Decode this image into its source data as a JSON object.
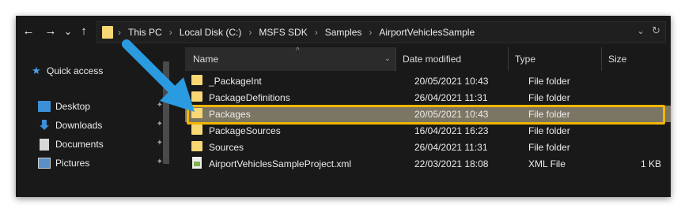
{
  "navigation": {
    "back_icon": "←",
    "forward_icon": "→",
    "recent_icon": "⌄",
    "up_icon": "↑"
  },
  "address": {
    "crumbs": [
      "This PC",
      "Local Disk (C:)",
      "MSFS SDK",
      "Samples",
      "AirportVehiclesSample"
    ],
    "separator": "›",
    "dropdown_icon": "⌄",
    "refresh_icon": "↻"
  },
  "sidebar": {
    "quick_access": "Quick access",
    "items": [
      {
        "label": "Desktop",
        "icon": "desktop-icon"
      },
      {
        "label": "Downloads",
        "icon": "downloads-icon"
      },
      {
        "label": "Documents",
        "icon": "documents-icon"
      },
      {
        "label": "Pictures",
        "icon": "pictures-icon"
      }
    ],
    "pin_icon": "📌"
  },
  "columns": {
    "name": "Name",
    "date": "Date modified",
    "type": "Type",
    "size": "Size",
    "sort_icon": "^",
    "name_dropdown_icon": "⌄"
  },
  "files": [
    {
      "name": "_PackageInt",
      "date": "20/05/2021 10:43",
      "type": "File folder",
      "size": "",
      "icon": "folder-icon"
    },
    {
      "name": "PackageDefinitions",
      "date": "26/04/2021 11:31",
      "type": "File folder",
      "size": "",
      "icon": "folder-icon"
    },
    {
      "name": "Packages",
      "date": "20/05/2021 10:43",
      "type": "File folder",
      "size": "",
      "icon": "folder-icon",
      "selected": true
    },
    {
      "name": "PackageSources",
      "date": "16/04/2021 16:23",
      "type": "File folder",
      "size": "",
      "icon": "folder-icon"
    },
    {
      "name": "Sources",
      "date": "26/04/2021 11:31",
      "type": "File folder",
      "size": "",
      "icon": "folder-icon"
    },
    {
      "name": "AirportVehiclesSampleProject.xml",
      "date": "22/03/2021 18:08",
      "type": "XML File",
      "size": "1 KB",
      "icon": "xml-file-icon"
    }
  ],
  "colors": {
    "window_bg": "#191919",
    "selection": "#7b7563",
    "highlight": "#f2b600",
    "folder": "#f8d775",
    "accent_blue": "#3d8fd8",
    "arrow": "#2a9be0"
  }
}
